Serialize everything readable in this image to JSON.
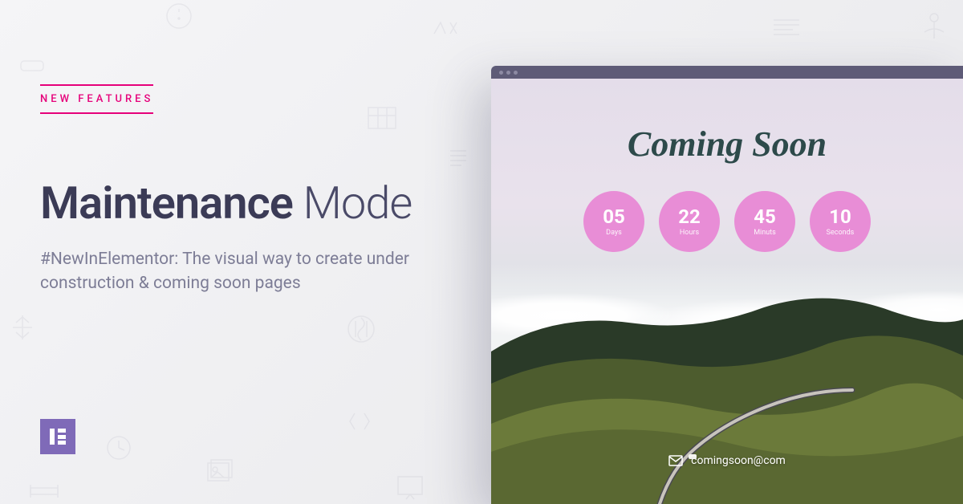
{
  "badge": "NEW FEATURES",
  "title_bold": "Maintenance",
  "title_light": " Mode",
  "subtitle": "#NewInElementor: The visual way to create under construction & coming soon pages",
  "preview": {
    "heading": "Coming Soon",
    "email": "comingsoon@com",
    "countdown": [
      {
        "value": "05",
        "unit": "Days"
      },
      {
        "value": "22",
        "unit": "Hours"
      },
      {
        "value": "45",
        "unit": "Minuts"
      },
      {
        "value": "10",
        "unit": "Seconds"
      }
    ]
  }
}
